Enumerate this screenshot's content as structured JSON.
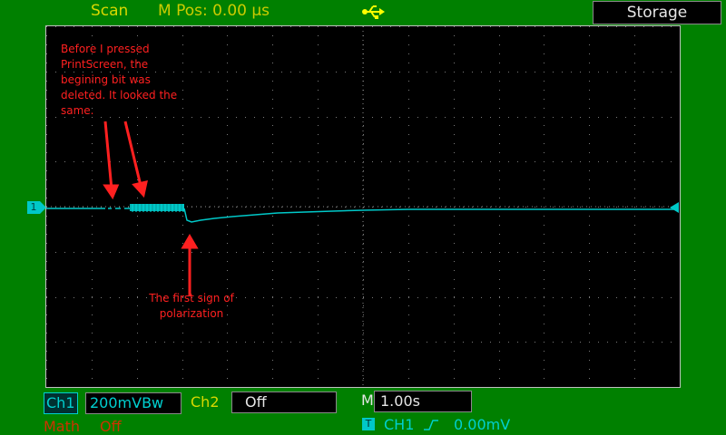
{
  "header": {
    "mode": "Scan",
    "position": "M Pos: 0.00 µs",
    "menu_title": "Storage"
  },
  "icons": {
    "usb": "usb-icon",
    "ch1_marker": "ground-marker-icon",
    "trigger_marker": "trigger-level-icon",
    "trigger_slope": "rising-edge-icon"
  },
  "colors": {
    "background": "#008000",
    "screen": "#000000",
    "trace": "#00c8c8",
    "annotation": "#ff2020",
    "header_text": "#d8d800"
  },
  "annotations": {
    "note1": "Before I pressed PrintScreen, the begining bit was deleted. It looked the same.",
    "note2": "The first sign of polarization"
  },
  "markers": {
    "ch1": "1"
  },
  "footer": {
    "ch1_label": "Ch1",
    "ch1_scale": "200mVBw",
    "ch2_label": "Ch2",
    "ch2_state": "Off",
    "math_label": "Math",
    "math_state": "Off",
    "timebase_label": "M",
    "timebase_value": "1.00s",
    "trigger_badge": "T",
    "trigger_source": "CH1",
    "trigger_level": "0.00mV"
  }
}
